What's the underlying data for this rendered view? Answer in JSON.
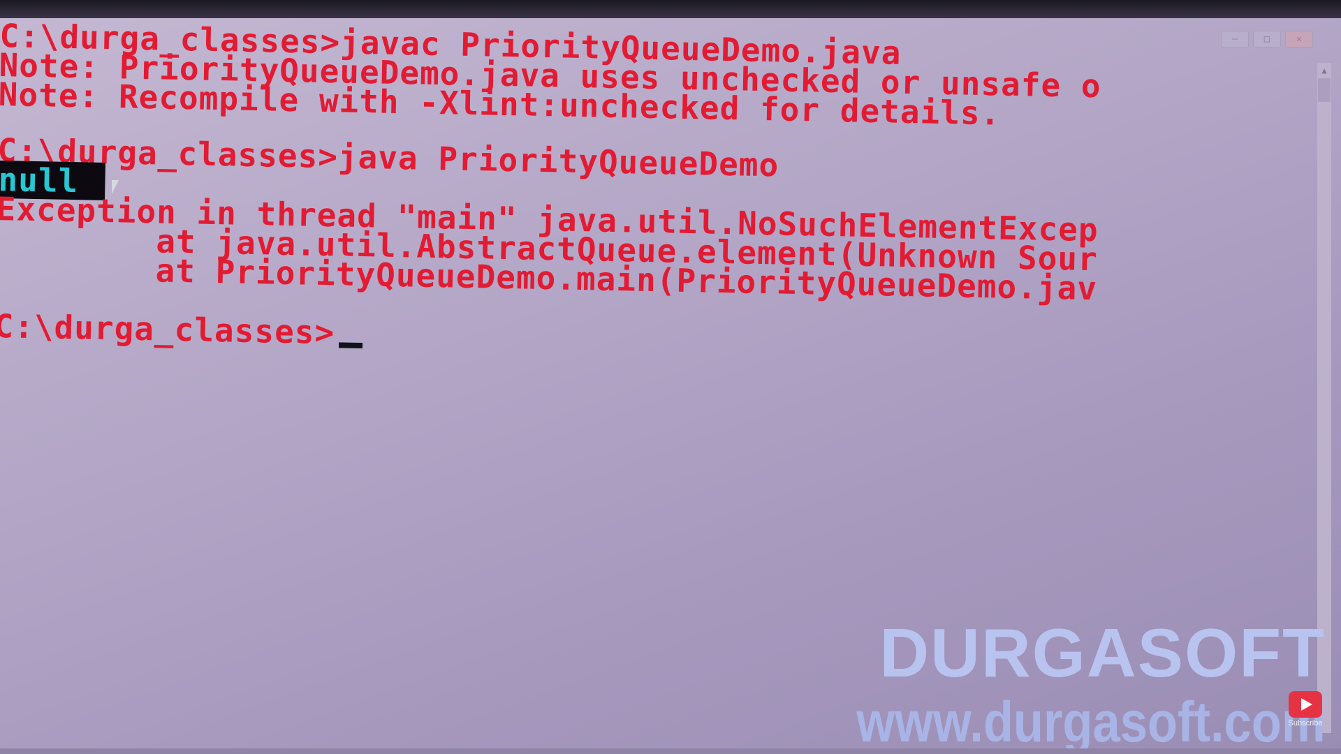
{
  "window": {
    "controls": {
      "minimize": "—",
      "maximize": "□",
      "close": "✕"
    },
    "scroll_up_glyph": "▲"
  },
  "terminal": {
    "lines": [
      "C:\\durga_classes>javac PriorityQueueDemo.java",
      "Note: PriorityQueueDemo.java uses unchecked or unsafe o",
      "Note: Recompile with -Xlint:unchecked for details.",
      "",
      "C:\\durga_classes>java PriorityQueueDemo",
      "null",
      "Exception in thread \"main\" java.util.NoSuchElementExcep",
      "        at java.util.AbstractQueue.element(Unknown Sour",
      "        at PriorityQueueDemo.main(PriorityQueueDemo.jav",
      "",
      "C:\\durga_classes>"
    ]
  },
  "watermark": {
    "brand": "DURGASOFT",
    "site": "www.durgasoft.com"
  },
  "subscribe": {
    "label": "Subscribe"
  },
  "colors": {
    "terminal_text": "#e21b33",
    "terminal_background": "#b3a6c6",
    "highlight_text": "#27c7d4",
    "watermark": "#b8c4ef"
  },
  "icons": {
    "mouse": "mouse-pointer-icon",
    "subscribe": "play-icon"
  }
}
